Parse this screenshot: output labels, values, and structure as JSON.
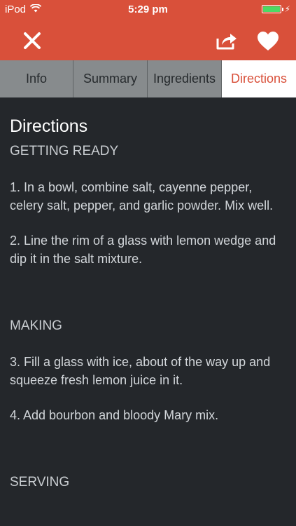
{
  "status_bar": {
    "carrier": "iPod",
    "time": "5:29 pm",
    "battery_level": 1.0
  },
  "navbar": {
    "close_icon": "close-icon",
    "share_icon": "share-icon",
    "favorite_icon": "heart-icon"
  },
  "tabs": [
    {
      "label": "Info",
      "active": false
    },
    {
      "label": "Summary",
      "active": false
    },
    {
      "label": "Ingredients",
      "active": false
    },
    {
      "label": "Directions",
      "active": true
    }
  ],
  "content": {
    "title": "Directions",
    "sections": [
      {
        "heading": "GETTING READY",
        "steps": [
          "1. In a bowl, combine salt, cayenne pepper, celery salt, pepper, and garlic powder. Mix well.",
          "2. Line the rim of a glass with lemon wedge and dip it in the salt mixture."
        ]
      },
      {
        "heading": "MAKING",
        "steps": [
          "3. Fill a glass with ice, about  of the way up and squeeze fresh lemon juice in it.",
          "4. Add bourbon and bloody Mary mix."
        ]
      },
      {
        "heading": "SERVING",
        "steps": []
      }
    ]
  },
  "colors": {
    "accent": "#d9503a",
    "background": "#24272b",
    "tab_inactive": "#878b8d",
    "battery": "#4cd964"
  }
}
